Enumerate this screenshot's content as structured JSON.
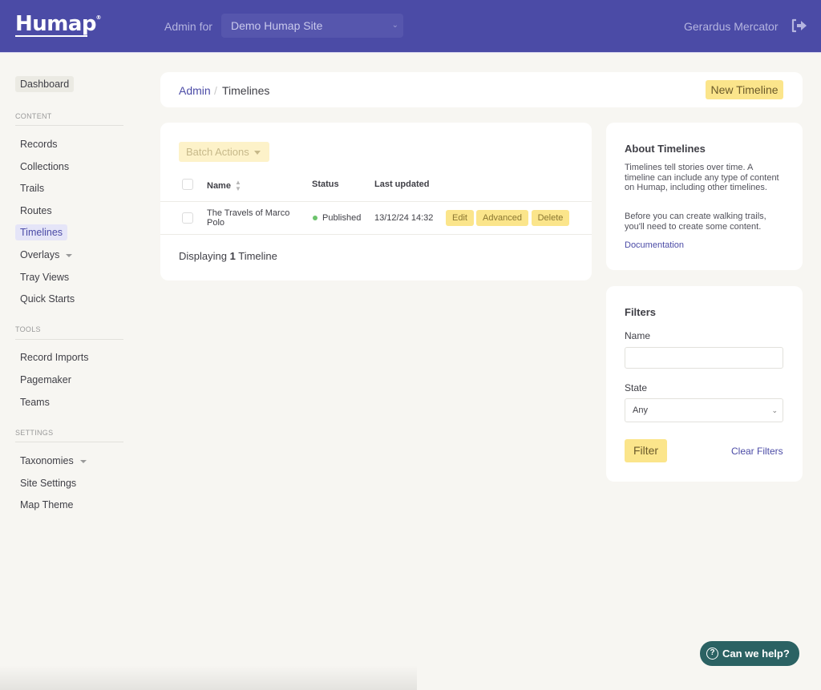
{
  "header": {
    "logo": "Humap",
    "logo_mark": "®",
    "admin_for_label": "Admin for",
    "site_select_value": "Demo Humap Site",
    "user_name": "Gerardus Mercator",
    "logout_icon": "sign-out-icon"
  },
  "sidebar": {
    "dashboard": "Dashboard",
    "sections": [
      {
        "heading": "CONTENT",
        "items": [
          {
            "label": "Records"
          },
          {
            "label": "Collections"
          },
          {
            "label": "Trails"
          },
          {
            "label": "Routes"
          },
          {
            "label": "Timelines",
            "active": true
          },
          {
            "label": "Overlays",
            "has_dropdown": true
          },
          {
            "label": "Tray Views"
          },
          {
            "label": "Quick Starts"
          }
        ]
      },
      {
        "heading": "TOOLS",
        "items": [
          {
            "label": "Record Imports"
          },
          {
            "label": "Pagemaker"
          },
          {
            "label": "Teams"
          }
        ]
      },
      {
        "heading": "SETTINGS",
        "items": [
          {
            "label": "Taxonomies",
            "has_dropdown": true
          },
          {
            "label": "Site Settings"
          },
          {
            "label": "Map Theme"
          }
        ]
      }
    ]
  },
  "breadcrumb": {
    "root": "Admin",
    "separator": "/",
    "current": "Timelines",
    "new_button": "New Timeline"
  },
  "list": {
    "batch_actions": "Batch Actions",
    "columns": {
      "name": "Name",
      "status": "Status",
      "last_updated": "Last updated"
    },
    "rows": [
      {
        "name": "The Travels of Marco Polo",
        "status": "Published",
        "status_color": "#6cc36c",
        "last_updated": "13/12/24 14:32",
        "actions": [
          "Edit",
          "Advanced",
          "Delete"
        ]
      }
    ],
    "footer_prefix": "Displaying",
    "footer_count": "1",
    "footer_suffix": "Timeline"
  },
  "about": {
    "title": "About Timelines",
    "paragraph1": "Timelines tell stories over time. A timeline can include any type of content on Humap, including other timelines.",
    "paragraph2": "Before you can create walking trails, you'll need to create some content.",
    "link": "Documentation"
  },
  "filters": {
    "title": "Filters",
    "name_label": "Name",
    "name_value": "",
    "state_label": "State",
    "state_value": "Any",
    "filter_button": "Filter",
    "clear_link": "Clear Filters"
  },
  "help": {
    "label": "Can we help?",
    "icon": "?"
  },
  "colors": {
    "brand": "#4b4ba6",
    "accent_yellow": "#fbe58b",
    "help_teal": "#2b6263",
    "background": "#f7f6f2"
  }
}
